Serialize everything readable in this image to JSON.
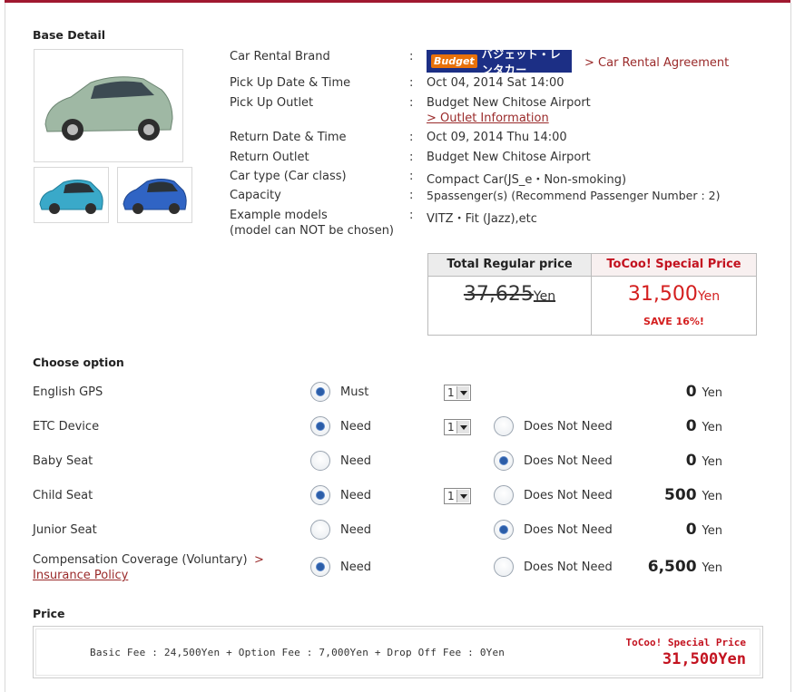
{
  "base": {
    "heading": "Base Detail",
    "rows": [
      {
        "label": "Car Rental Brand",
        "value": ""
      },
      {
        "label": "Pick Up Date & Time",
        "value": "Oct 04, 2014 Sat 14:00"
      },
      {
        "label": "Pick Up Outlet",
        "value": "Budget New Chitose Airport"
      },
      {
        "label": "Return Date & Time",
        "value": "Oct 09, 2014 Thu 14:00"
      },
      {
        "label": "Return Outlet",
        "value": "Budget New Chitose Airport"
      },
      {
        "label": "Car type (Car class)",
        "value": "Compact Car(JS_e・Non-smoking)"
      },
      {
        "label": "Capacity",
        "value": "5passenger(s) (Recommend Passenger Number : 2)"
      },
      {
        "label": "Example models",
        "label2": "(model can NOT be chosen)",
        "value": "VITZ・Fit (Jazz),etc"
      }
    ],
    "colon": ":",
    "brand_logo": {
      "mark": "Budget",
      "text": "バジェット・レンタカー",
      "color": "#1c2f85",
      "accent": "#e8710a"
    },
    "agreement_link": "> Car Rental Agreement",
    "outlet_link": "> Outlet Information"
  },
  "price_box": {
    "regular_header": "Total Regular price",
    "special_header": "ToCoo! Special Price",
    "regular_amount": "37,625",
    "special_amount": "31,500",
    "unit": "Yen",
    "save": "SAVE 16%!",
    "accent": "#d41f1f"
  },
  "options": {
    "heading": "Choose option",
    "rows": [
      {
        "label": "English GPS",
        "opt1": "Must",
        "opt1_on": true,
        "qty": "1",
        "opt2": "",
        "opt2_on": false,
        "amount": "0",
        "unit": "Yen"
      },
      {
        "label": "ETC Device",
        "opt1": "Need",
        "opt1_on": true,
        "qty": "1",
        "opt2": "Does Not Need",
        "opt2_on": false,
        "amount": "0",
        "unit": "Yen"
      },
      {
        "label": "Baby Seat",
        "opt1": "Need",
        "opt1_on": false,
        "qty": "",
        "opt2": "Does Not Need",
        "opt2_on": true,
        "amount": "0",
        "unit": "Yen"
      },
      {
        "label": "Child Seat",
        "opt1": "Need",
        "opt1_on": true,
        "qty": "1",
        "opt2": "Does Not Need",
        "opt2_on": false,
        "amount": "500",
        "unit": "Yen"
      },
      {
        "label": "Junior Seat",
        "opt1": "Need",
        "opt1_on": false,
        "qty": "",
        "opt2": "Does Not Need",
        "opt2_on": true,
        "amount": "0",
        "unit": "Yen"
      },
      {
        "label": "Compensation Coverage (Voluntary)",
        "link_arrow": ">",
        "link": "Insurance Policy",
        "opt1": "Need",
        "opt1_on": true,
        "qty": "",
        "opt2": "Does Not Need",
        "opt2_on": false,
        "amount": "6,500",
        "unit": "Yen"
      }
    ]
  },
  "price": {
    "heading": "Price",
    "fee_text": "Basic Fee : 24,500Yen + Option Fee : 7,000Yen + Drop Off Fee : 0Yen",
    "special_label": "ToCoo! Special Price",
    "total": "31,500Yen"
  }
}
